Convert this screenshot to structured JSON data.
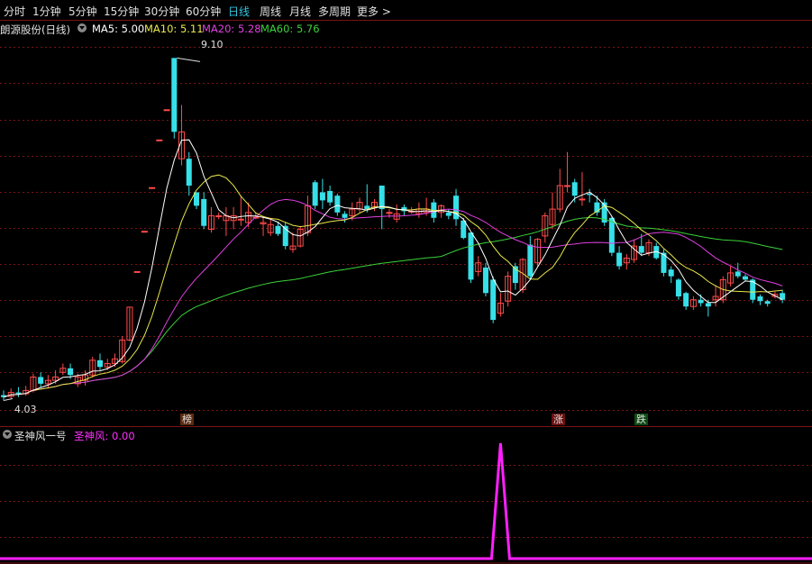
{
  "toolbar": {
    "tabs": [
      "分时",
      "1分钟",
      "5分钟",
      "15分钟",
      "30分钟",
      "60分钟",
      "日线",
      "周线",
      "月线",
      "多周期",
      "更多 >"
    ],
    "active": "日线"
  },
  "main_legend": {
    "title": "朗源股份(日线)",
    "ma5": "MA5: 5.00",
    "ma10": "MA10: 5.11",
    "ma20": "MA20: 5.28",
    "ma60": "MA60: 5.76"
  },
  "price_labels": {
    "high": "9.10",
    "low": "4.03"
  },
  "markers": {
    "bang": "榜",
    "zhang": "涨",
    "die": "跌"
  },
  "sub_legend": {
    "title": "圣神风一号",
    "indicator": "圣神风: 0.00"
  },
  "colors": {
    "up": "#ff4a4a",
    "down": "#36e0e8",
    "ma5": "#ffffff",
    "ma10": "#e8e84a",
    "ma20": "#e040e0",
    "ma60": "#3ad23a",
    "indicator": "#ff20ff",
    "grid": "#7a1414"
  },
  "chart_data": {
    "type": "candlestick",
    "price_range": [
      3.9,
      9.4
    ],
    "candles": [
      [
        4.08,
        4.05,
        4.15,
        4.0
      ],
      [
        4.06,
        4.12,
        4.18,
        4.03
      ],
      [
        4.12,
        4.1,
        4.2,
        4.05
      ],
      [
        4.1,
        4.15,
        4.22,
        4.07
      ],
      [
        4.15,
        4.35,
        4.4,
        4.12
      ],
      [
        4.35,
        4.25,
        4.42,
        4.2
      ],
      [
        4.25,
        4.3,
        4.38,
        4.18
      ],
      [
        4.3,
        4.35,
        4.45,
        4.25
      ],
      [
        4.42,
        4.48,
        4.55,
        4.38
      ],
      [
        4.48,
        4.38,
        4.55,
        4.32
      ],
      [
        4.25,
        4.35,
        4.4,
        4.2
      ],
      [
        4.3,
        4.38,
        4.45,
        4.22
      ],
      [
        4.38,
        4.6,
        4.65,
        4.34
      ],
      [
        4.6,
        4.5,
        4.7,
        4.45
      ],
      [
        4.5,
        4.55,
        4.62,
        4.45
      ],
      [
        4.55,
        4.62,
        4.7,
        4.5
      ],
      [
        4.58,
        4.9,
        4.96,
        4.55
      ],
      [
        4.9,
        5.39,
        5.39,
        4.88
      ],
      [
        5.92,
        5.92,
        5.92,
        5.92
      ],
      [
        6.52,
        6.52,
        6.52,
        6.52
      ],
      [
        7.17,
        7.17,
        7.17,
        7.17
      ],
      [
        7.88,
        7.88,
        7.88,
        7.88
      ],
      [
        8.33,
        8.33,
        8.33,
        8.33
      ],
      [
        9.1,
        8.0,
        9.1,
        7.9
      ],
      [
        7.6,
        8.0,
        8.4,
        7.5
      ],
      [
        7.6,
        7.2,
        7.7,
        7.05
      ],
      [
        7.1,
        6.9,
        7.1,
        6.85
      ],
      [
        7.0,
        6.6,
        7.1,
        6.55
      ],
      [
        6.55,
        6.75,
        6.88,
        6.5
      ],
      [
        6.75,
        6.75,
        6.8,
        6.7
      ],
      [
        6.68,
        6.75,
        6.88,
        6.45
      ],
      [
        6.68,
        6.75,
        6.88,
        6.55
      ],
      [
        6.7,
        6.7,
        7.05,
        6.6
      ],
      [
        6.65,
        6.8,
        6.95,
        6.58
      ],
      [
        6.73,
        6.73,
        6.8,
        6.7
      ],
      [
        6.63,
        6.65,
        6.75,
        6.45
      ],
      [
        6.5,
        6.62,
        6.72,
        6.45
      ],
      [
        6.6,
        6.48,
        6.66,
        6.45
      ],
      [
        6.6,
        6.3,
        6.66,
        6.25
      ],
      [
        6.25,
        6.3,
        6.5,
        6.2
      ],
      [
        6.3,
        6.55,
        6.6,
        6.28
      ],
      [
        6.5,
        6.9,
        7.05,
        6.45
      ],
      [
        7.25,
        6.9,
        7.28,
        6.85
      ],
      [
        7.1,
        6.98,
        7.3,
        6.85
      ],
      [
        7.12,
        6.95,
        7.2,
        6.9
      ],
      [
        7.05,
        6.8,
        7.08,
        6.75
      ],
      [
        6.78,
        6.72,
        6.82,
        6.65
      ],
      [
        6.75,
        6.85,
        6.95,
        6.68
      ],
      [
        6.85,
        6.95,
        7.02,
        6.8
      ],
      [
        6.9,
        6.85,
        7.22,
        6.8
      ],
      [
        6.88,
        6.95,
        7.0,
        6.82
      ],
      [
        7.2,
        6.85,
        7.2,
        6.55
      ],
      [
        6.8,
        6.8,
        6.85,
        6.72
      ],
      [
        6.7,
        6.78,
        6.92,
        6.65
      ],
      [
        6.88,
        6.82,
        6.92,
        6.75
      ],
      [
        6.82,
        6.82,
        6.88,
        6.78
      ],
      [
        6.78,
        6.85,
        6.95,
        6.72
      ],
      [
        6.8,
        6.85,
        7.02,
        6.75
      ],
      [
        6.95,
        6.72,
        7.0,
        6.65
      ],
      [
        6.8,
        6.9,
        6.92,
        6.72
      ],
      [
        6.8,
        6.75,
        6.85,
        6.7
      ],
      [
        7.05,
        6.7,
        7.15,
        6.6
      ],
      [
        6.68,
        6.42,
        6.72,
        6.4
      ],
      [
        6.5,
        5.8,
        6.5,
        5.75
      ],
      [
        5.92,
        6.05,
        6.15,
        5.85
      ],
      [
        5.98,
        5.6,
        6.05,
        5.55
      ],
      [
        5.8,
        5.2,
        5.85,
        5.15
      ],
      [
        5.3,
        5.45,
        5.6,
        5.25
      ],
      [
        5.48,
        5.85,
        5.92,
        5.4
      ],
      [
        6.0,
        5.75,
        6.05,
        5.65
      ],
      [
        5.65,
        6.1,
        6.12,
        5.6
      ],
      [
        6.32,
        5.85,
        6.45,
        5.8
      ],
      [
        6.05,
        6.4,
        6.42,
        6.0
      ],
      [
        6.45,
        6.75,
        6.8,
        6.35
      ],
      [
        6.62,
        6.85,
        7.1,
        6.55
      ],
      [
        6.85,
        7.2,
        7.45,
        6.8
      ],
      [
        7.2,
        7.2,
        7.7,
        7.1
      ],
      [
        7.25,
        7.05,
        7.3,
        6.95
      ],
      [
        7.0,
        7.0,
        7.4,
        6.9
      ],
      [
        7.08,
        7.06,
        7.15,
        6.95
      ],
      [
        6.95,
        6.8,
        7.05,
        6.75
      ],
      [
        6.95,
        6.65,
        7.0,
        6.6
      ],
      [
        6.72,
        6.2,
        6.75,
        6.15
      ],
      [
        6.2,
        6.0,
        6.3,
        5.95
      ],
      [
        6.05,
        6.12,
        6.18,
        5.95
      ],
      [
        6.1,
        6.3,
        6.4,
        6.05
      ],
      [
        6.3,
        6.2,
        6.48,
        6.15
      ],
      [
        6.2,
        6.35,
        6.4,
        6.15
      ],
      [
        6.3,
        6.12,
        6.35,
        6.1
      ],
      [
        6.2,
        5.9,
        6.25,
        5.85
      ],
      [
        5.95,
        5.85,
        6.0,
        5.75
      ],
      [
        5.8,
        5.55,
        5.82,
        5.5
      ],
      [
        5.6,
        5.4,
        5.62,
        5.35
      ],
      [
        5.4,
        5.5,
        5.55,
        5.35
      ],
      [
        5.5,
        5.45,
        5.58,
        5.4
      ],
      [
        5.45,
        5.4,
        5.5,
        5.25
      ],
      [
        5.5,
        5.55,
        5.72,
        5.4
      ],
      [
        5.5,
        5.8,
        5.85,
        5.45
      ],
      [
        5.75,
        5.9,
        6.0,
        5.7
      ],
      [
        5.92,
        5.85,
        6.05,
        5.82
      ],
      [
        5.85,
        5.8,
        5.88,
        5.78
      ],
      [
        5.8,
        5.5,
        5.82,
        5.45
      ],
      [
        5.55,
        5.48,
        5.58,
        5.42
      ],
      [
        5.48,
        5.44,
        5.5,
        5.4
      ],
      [
        5.55,
        5.58,
        5.62,
        5.52
      ],
      [
        5.6,
        5.5,
        5.65,
        5.45
      ]
    ],
    "ma60_start_index": 10,
    "indicator": {
      "name": "圣神风",
      "spike_index": 67,
      "spike_value": 1,
      "baseline": 0
    }
  }
}
